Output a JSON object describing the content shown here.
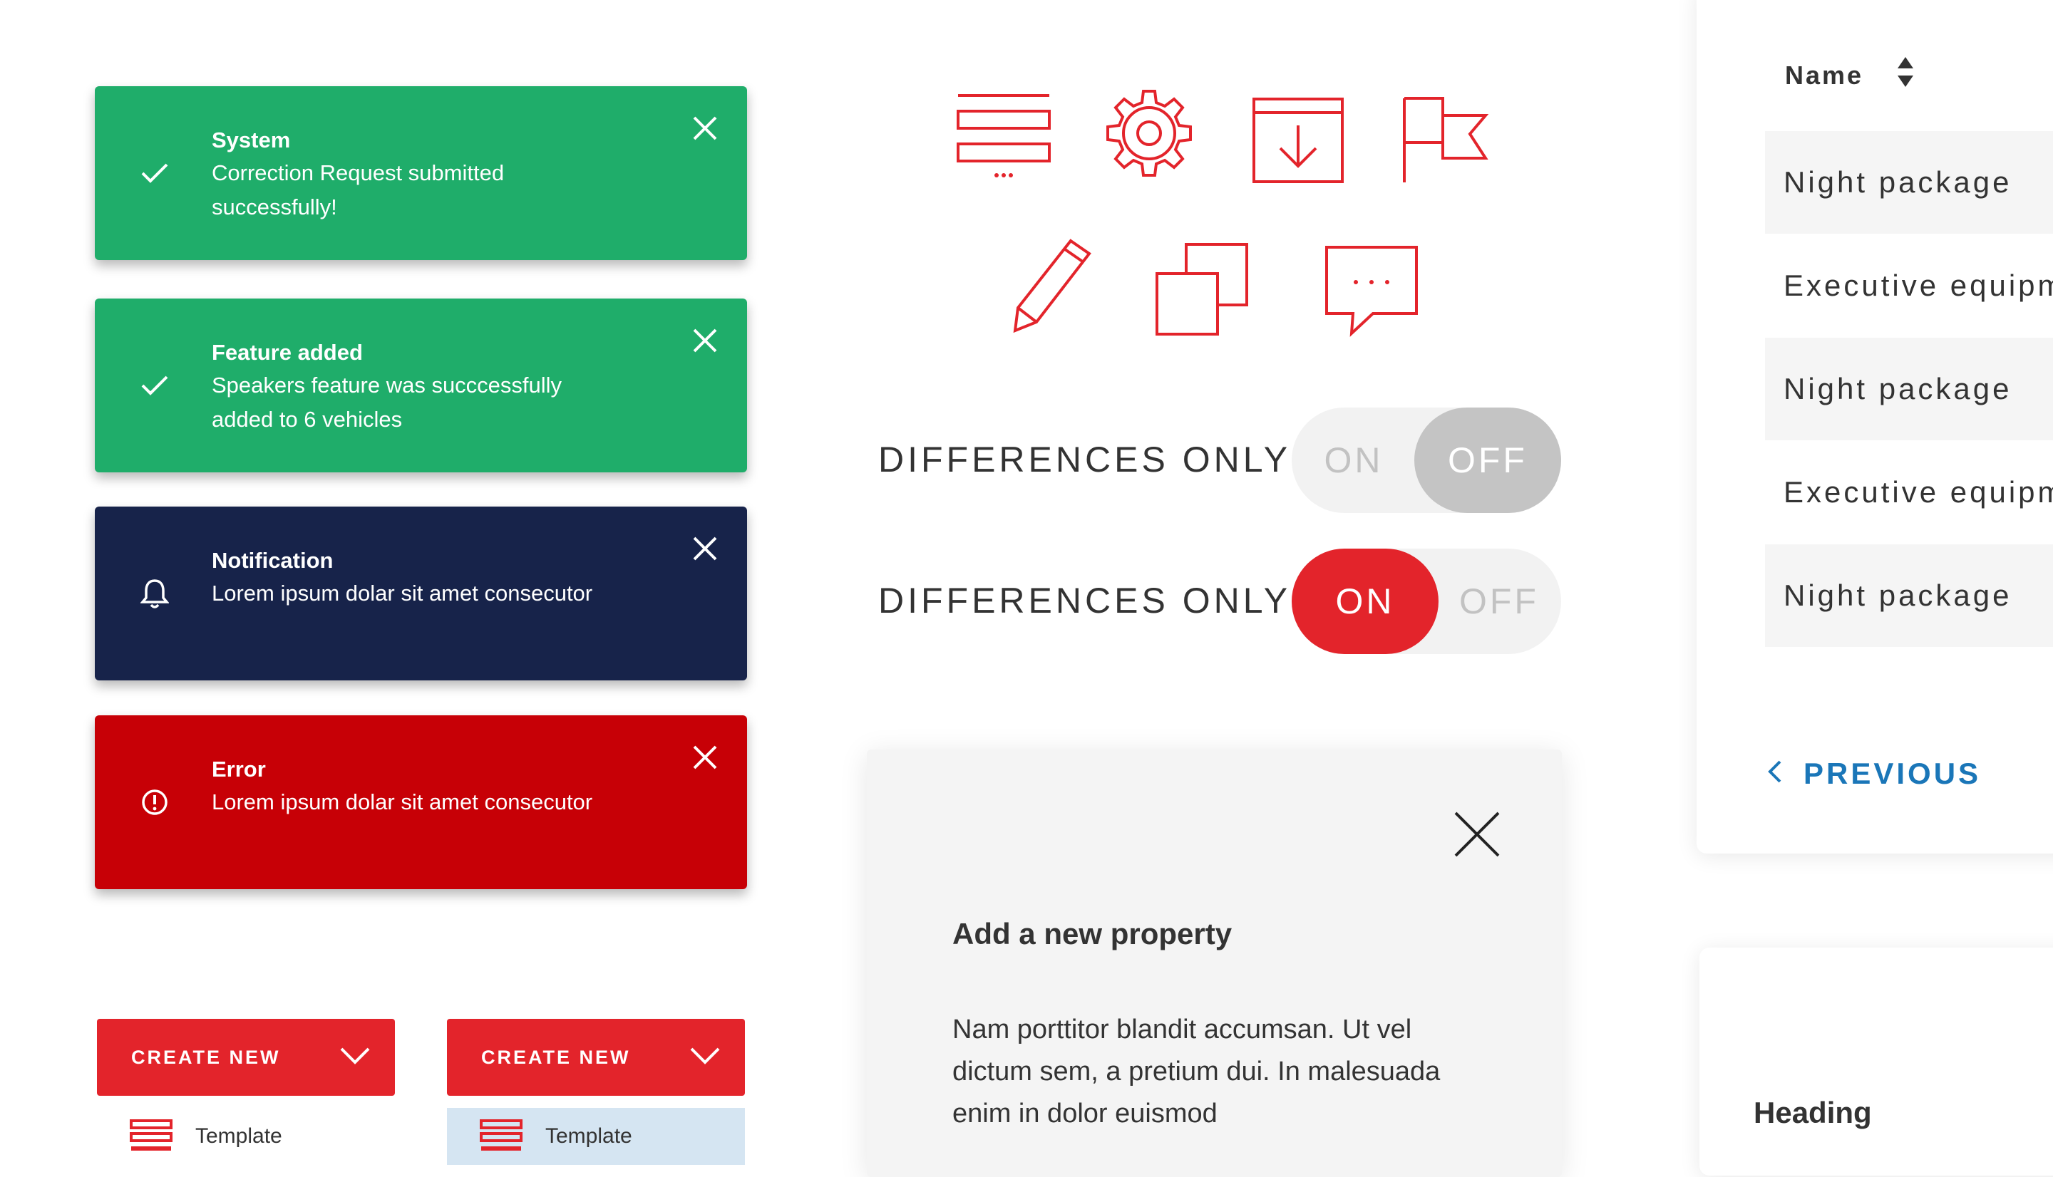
{
  "toasts": [
    {
      "title": "System",
      "message": "Correction Request submitted successfully!",
      "icon": "check-icon",
      "color": "#1fad6a"
    },
    {
      "title": "Feature added",
      "message": "Speakers feature was succcessfully added to 6 vehicles",
      "icon": "check-icon",
      "color": "#1fad6a"
    },
    {
      "title": "Notification",
      "message": "Lorem ipsum dolar sit amet consecutor",
      "icon": "bell-icon",
      "color": "#17234a"
    },
    {
      "title": "Error",
      "message": "Lorem ipsum dolar sit amet consecutor",
      "icon": "alert-circle-icon",
      "color": "#c70006"
    }
  ],
  "create_buttons": [
    {
      "label": "CREATE NEW",
      "item_label": "Template"
    },
    {
      "label": "CREATE NEW",
      "item_label": "Template"
    }
  ],
  "icons": [
    "list-menu-icon",
    "gear-icon",
    "download-icon",
    "flag-icon",
    "pencil-icon",
    "duplicate-icon",
    "comment-icon"
  ],
  "toggles": [
    {
      "label": "DIFFERENCES ONLY",
      "on": "ON",
      "off": "OFF",
      "state": "off"
    },
    {
      "label": "DIFFERENCES ONLY",
      "on": "ON",
      "off": "OFF",
      "state": "on"
    }
  ],
  "modal": {
    "title": "Add a new property",
    "body": "Nam porttitor blandit accumsan. Ut vel dictum sem, a pretium dui. In malesuada enim in dolor euismod"
  },
  "table": {
    "column": "Name",
    "rows": [
      "Night package",
      "Executive equipm",
      "Night package",
      "Executive equipm",
      "Night package"
    ],
    "previous": "PREVIOUS"
  },
  "card": {
    "heading": "Heading"
  },
  "colors": {
    "accent": "#e3242b",
    "success": "#1fad6a",
    "navy": "#17234a",
    "error": "#c70006",
    "link": "#1a76b8",
    "toggle_off_knob": "#c4c4c4"
  }
}
